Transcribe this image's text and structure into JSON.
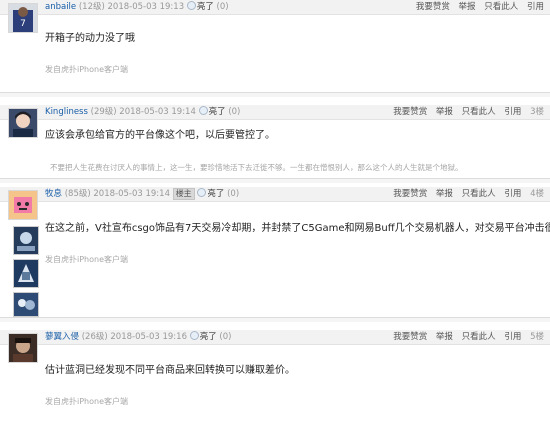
{
  "actions": {
    "report": "我要赞赏",
    "report2": "举报",
    "only_author": "只看此人",
    "quote": "引用"
  },
  "posts": [
    {
      "user": "anbaile",
      "level": "(12级)",
      "time": "2018-05-03 19:13",
      "light": "亮了",
      "light_count": "(0)",
      "floor": "",
      "content": "开箱子的动力没了哦",
      "device": "发自虎扑iPhone客户端"
    },
    {
      "user": "Kingliness",
      "level": "(29级)",
      "time": "2018-05-03 19:14",
      "light": "亮了",
      "light_count": "(0)",
      "floor": "3楼",
      "content": "应该会承包给官方的平台像这个吧，以后要管控了。",
      "signature": "不要把人生花费在讨厌人的事情上，这一生，要珍惜地活下去迁徙不够。一生都在憎恨别人，那么这个人的人生就是个地狱。"
    },
    {
      "user": "牧息",
      "level": "(85级)",
      "time": "2018-05-03 19:14",
      "tag": "楼主",
      "light": "亮了",
      "light_count": "(0)",
      "floor": "4楼",
      "content": "在这之前，V社宣布csgo饰品有7天交易冷却期，并封禁了C5Game和网易Buff几个交易机器人，对交易平台冲击很大。",
      "device": "发自虎扑iPhone客户端"
    },
    {
      "user": "蓼翼入侵",
      "level": "(26级)",
      "time": "2018-05-03 19:16",
      "light": "亮了",
      "light_count": "(0)",
      "floor": "5楼",
      "content": "估计蓝洞已经发现不同平台商品来回转换可以赚取差价。",
      "device": "发自虎扑iPhone客户端"
    }
  ]
}
